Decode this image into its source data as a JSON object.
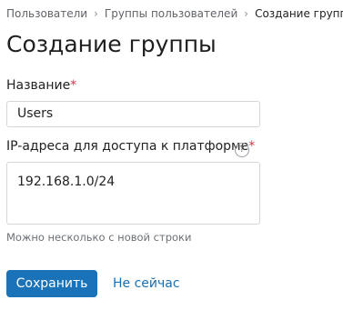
{
  "breadcrumb": {
    "items": [
      "Пользователи",
      "Группы пользователей"
    ],
    "current": "Создание группы",
    "separator": "›"
  },
  "page": {
    "title": "Создание группы"
  },
  "form": {
    "name_label": "Название",
    "name_required_mark": "*",
    "name_value": "Users",
    "ip_label": "IP-адреса для доступа к платформе",
    "ip_required_mark": "*",
    "ip_value": "192.168.1.0/24",
    "ip_help_icon": "?",
    "ip_hint": "Можно несколько с новой строки"
  },
  "actions": {
    "save_label": "Сохранить",
    "cancel_label": "Не сейчас"
  },
  "colors": {
    "primary": "#1a73b8",
    "link": "#1a6fb0",
    "required": "#d6334a"
  }
}
